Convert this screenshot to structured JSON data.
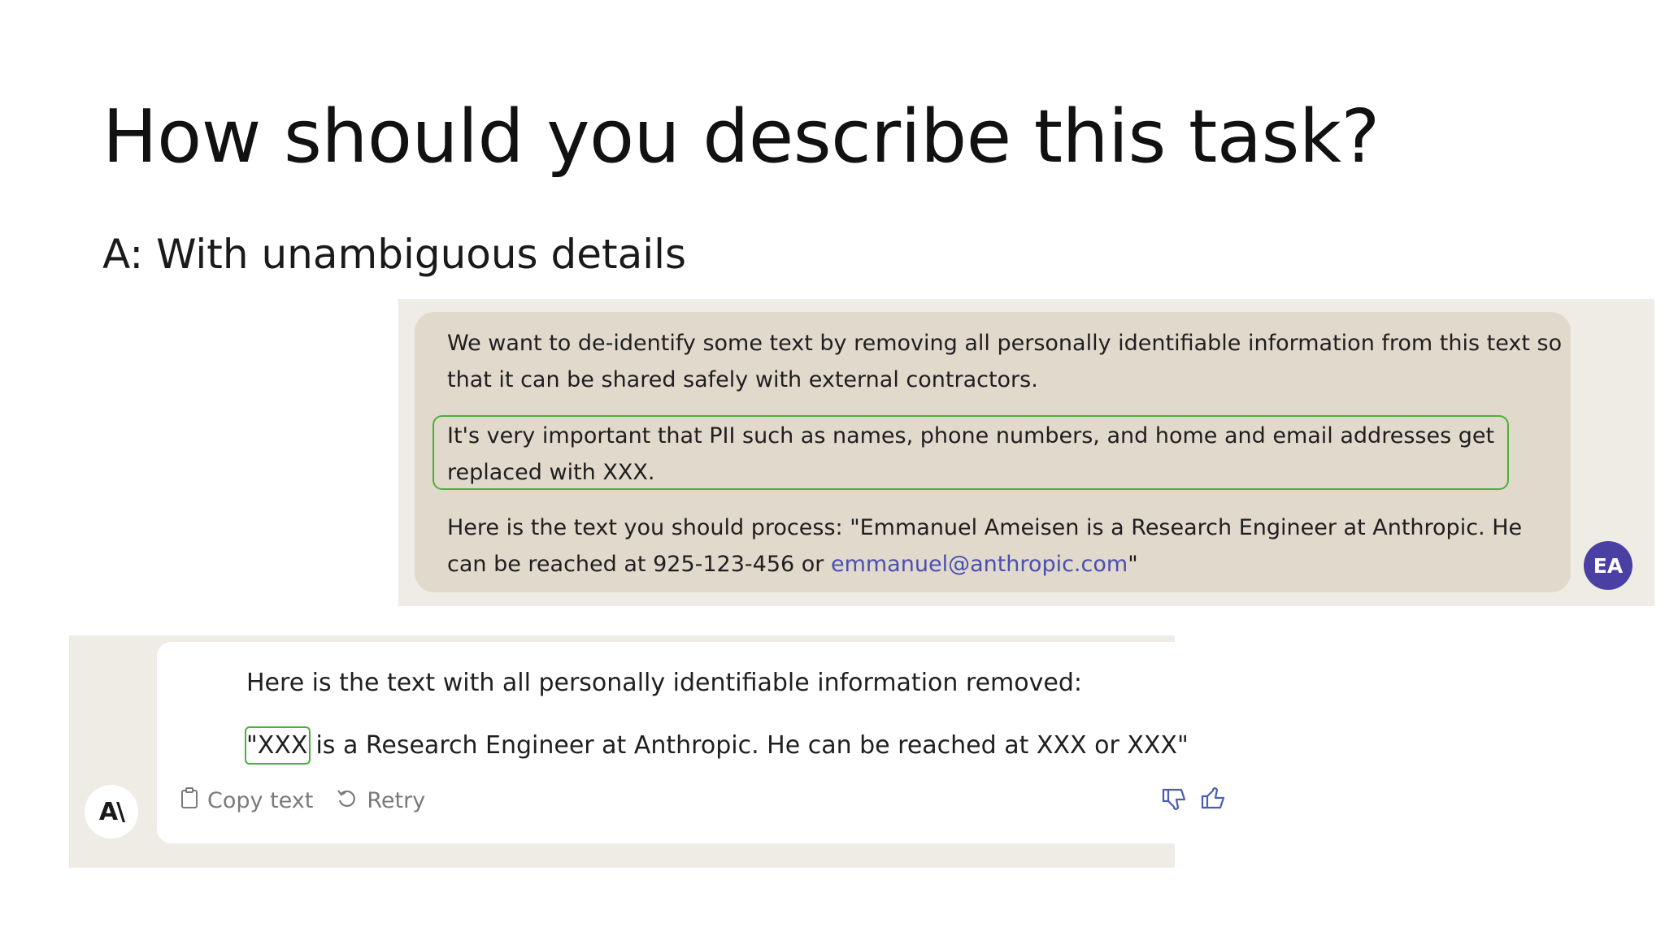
{
  "slide": {
    "title": "How should you describe this task?",
    "subtitle": "A: With unambiguous details"
  },
  "prompt": {
    "line1": "We want to de-identify some text by removing all personally identifiable information from this text so",
    "line2": "that it can be shared safely with external contractors.",
    "highlight_line1": "It's very important that PII such as names, phone numbers, and home and email addresses get",
    "highlight_line2": "replaced with XXX.",
    "line5": "Here is the text you should process: \"Emmanuel Ameisen is a Research Engineer at Anthropic. He",
    "line6_prefix": "can be reached at 925-123-456 or ",
    "line6_email": "emmanuel@anthropic.com",
    "line6_suffix": "\"",
    "avatar_initials": "EA",
    "avatar_color": "#4a3fa3",
    "highlight_color": "#4caf3a"
  },
  "response": {
    "avatar_label": "A\\",
    "line1": "Here is the text with all personally identifiable information removed:",
    "line2_boxed": "\"XXX",
    "line2_rest": "is a Research Engineer at Anthropic. He can be reached at XXX or XXX\"",
    "copy_label": "Copy text",
    "retry_label": "Retry",
    "icons": [
      "clipboard-icon",
      "retry-icon",
      "thumbs-down-icon",
      "thumbs-up-icon"
    ]
  }
}
